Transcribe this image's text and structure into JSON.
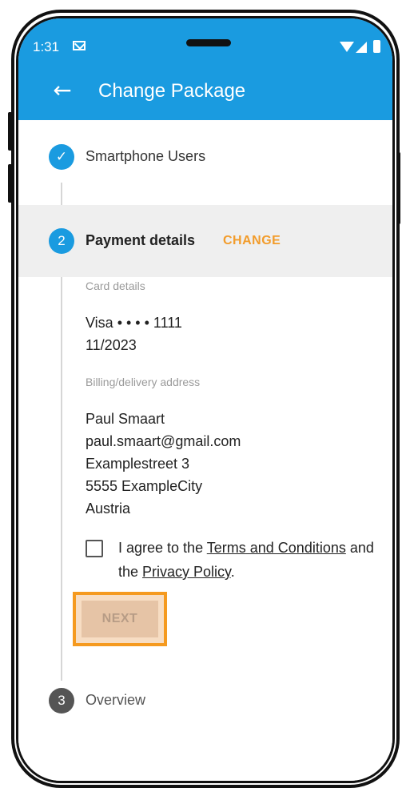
{
  "status_bar": {
    "time": "1:31",
    "icons": [
      "mail-icon",
      "wifi-icon",
      "signal-icon",
      "battery-icon"
    ]
  },
  "app_bar": {
    "back_icon": "back-arrow-icon",
    "title": "Change Package"
  },
  "steps": [
    {
      "number": "✓",
      "label": "Smartphone Users",
      "state": "completed"
    },
    {
      "number": "2",
      "label": "Payment details",
      "action": "CHANGE",
      "state": "active"
    },
    {
      "number": "3",
      "label": "Overview",
      "state": "pending"
    }
  ],
  "payment": {
    "card_label": "Card details",
    "card_number": "Visa • • • • 1111",
    "card_expiry": "11/2023",
    "address_label": "Billing/delivery address",
    "address_lines": [
      "Paul Smaart",
      "paul.smaart@gmail.com",
      "Examplestreet 3",
      "5555 ExampleCity",
      "Austria"
    ]
  },
  "agreement": {
    "prefix": "I agree to the ",
    "terms": "Terms and Conditions",
    "middle": " and the ",
    "privacy": "Privacy Policy",
    "suffix": "."
  },
  "next_button": {
    "label": "NEXT"
  },
  "colors": {
    "primary": "#1a9be0",
    "accent": "#f29c2b",
    "step_pending": "#555555"
  }
}
